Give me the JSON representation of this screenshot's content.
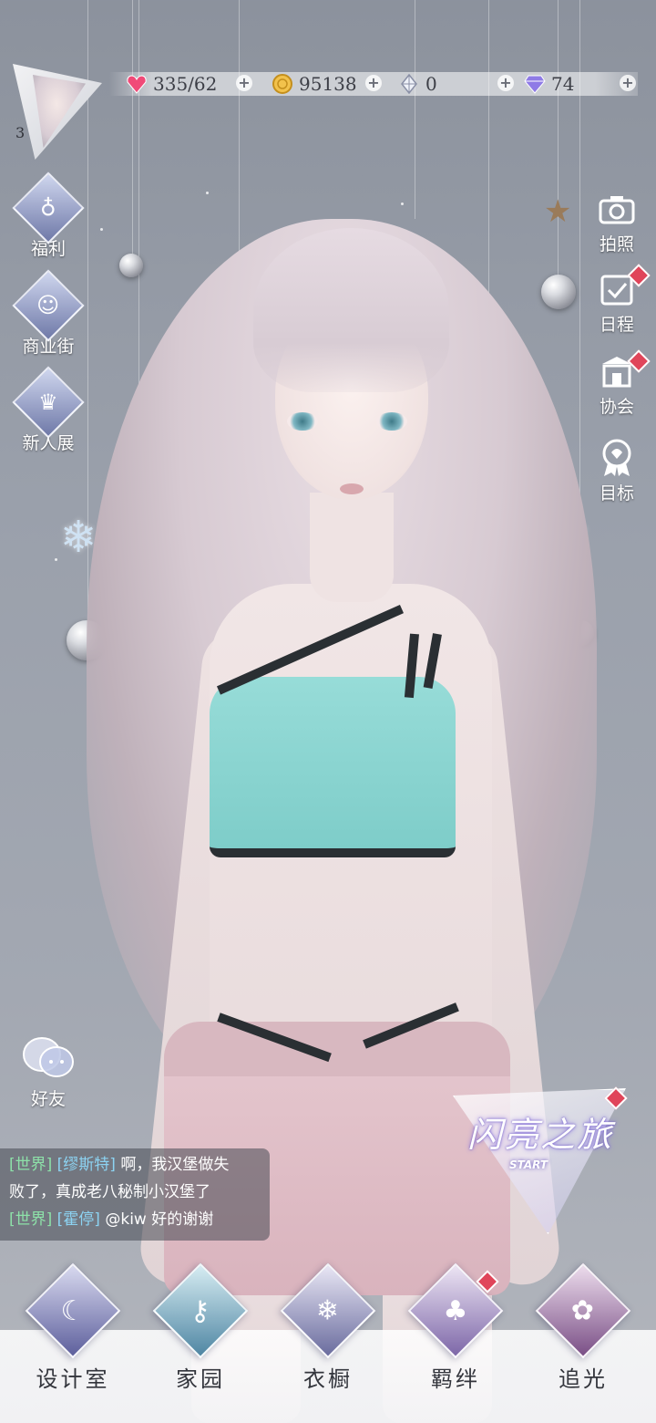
{
  "player": {
    "level": "3"
  },
  "resources": [
    {
      "name": "stamina",
      "icon": "heart-gem-icon",
      "value": "335/62"
    },
    {
      "name": "gold",
      "icon": "gold-coin-icon",
      "value": "95138"
    },
    {
      "name": "crystal",
      "icon": "crystal-icon",
      "value": "0"
    },
    {
      "name": "diamond",
      "icon": "diamond-icon",
      "value": "74"
    }
  ],
  "left_menu": [
    {
      "label": "福利",
      "icon": "balloon-icon"
    },
    {
      "label": "商业街",
      "icon": "shopping-bag-icon"
    },
    {
      "label": "新人展",
      "icon": "crown-icon"
    }
  ],
  "right_menu": [
    {
      "label": "拍照",
      "icon": "camera-icon"
    },
    {
      "label": "日程",
      "icon": "calendar-check-icon"
    },
    {
      "label": "协会",
      "icon": "guild-hall-icon"
    },
    {
      "label": "目标",
      "icon": "medal-icon"
    }
  ],
  "friends": {
    "label": "好友",
    "icon": "chat-bubbles-icon"
  },
  "chat": {
    "messages": [
      {
        "channel": "[世界]",
        "name": "[缪斯特]",
        "text": "啊，我汉堡做失"
      },
      {
        "channel": "",
        "name": "",
        "text": "败了，真成老八秘制小汉堡了"
      },
      {
        "channel": "[世界]",
        "name": "[霍停]",
        "text": "@kiw 好的谢谢"
      }
    ]
  },
  "journey": {
    "title": "闪亮之旅",
    "subtitle": "START"
  },
  "bottom_nav": [
    {
      "label": "设计室",
      "icon": "moon-pen-icon"
    },
    {
      "label": "家园",
      "icon": "key-icon"
    },
    {
      "label": "衣橱",
      "icon": "snowflake-crystal-icon"
    },
    {
      "label": "羁绊",
      "icon": "clover-icon"
    },
    {
      "label": "追光",
      "icon": "butterfly-icon"
    }
  ],
  "colors": {
    "accent": "#7a80b8",
    "badge": "#e0455a",
    "chat_channel": "#8de0a8",
    "chat_name": "#8cd3f2"
  }
}
